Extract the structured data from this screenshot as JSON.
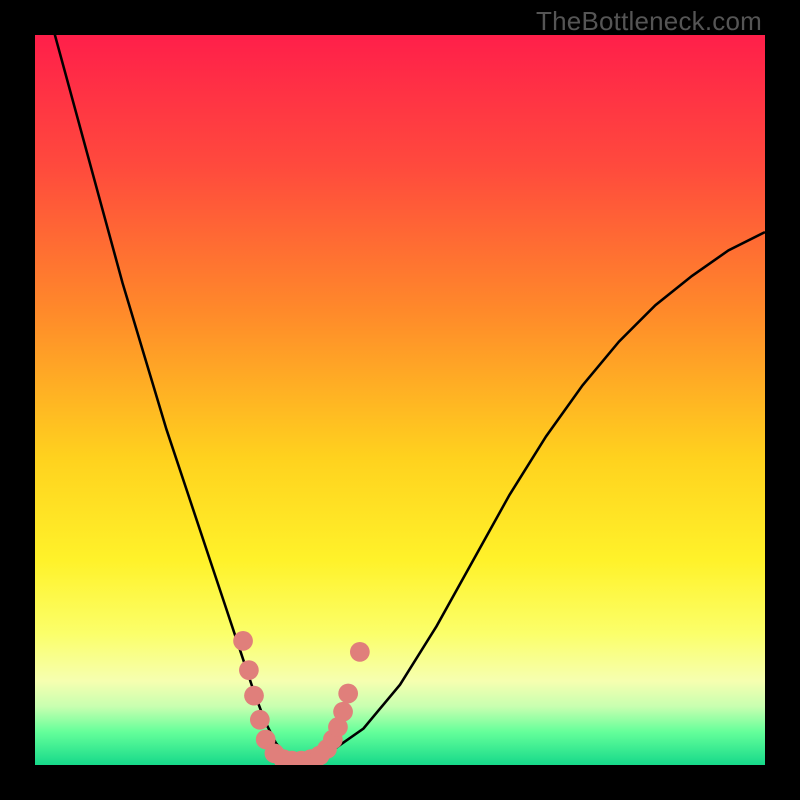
{
  "watermark": "TheBottleneck.com",
  "colors": {
    "frame": "#000000",
    "curve": "#000000",
    "marker": "#e07f7b",
    "gradient_stops": [
      {
        "offset": 0.0,
        "color": "#ff1f4a"
      },
      {
        "offset": 0.18,
        "color": "#ff4a3d"
      },
      {
        "offset": 0.38,
        "color": "#ff8a2a"
      },
      {
        "offset": 0.58,
        "color": "#ffd21e"
      },
      {
        "offset": 0.72,
        "color": "#fff22a"
      },
      {
        "offset": 0.82,
        "color": "#fbff6a"
      },
      {
        "offset": 0.885,
        "color": "#f6ffb0"
      },
      {
        "offset": 0.92,
        "color": "#c8ffb0"
      },
      {
        "offset": 0.955,
        "color": "#64ff9a"
      },
      {
        "offset": 1.0,
        "color": "#16d98a"
      }
    ]
  },
  "chart_data": {
    "type": "line",
    "title": "",
    "xlabel": "",
    "ylabel": "",
    "xlim": [
      0,
      100
    ],
    "ylim": [
      0,
      100
    ],
    "series": [
      {
        "name": "bottleneck-curve",
        "x": [
          0,
          3,
          6,
          9,
          12,
          15,
          18,
          21,
          24,
          26,
          28,
          30,
          31.5,
          33,
          34.5,
          36,
          40,
          45,
          50,
          55,
          60,
          65,
          70,
          75,
          80,
          85,
          90,
          95,
          100
        ],
        "y": [
          110,
          99,
          88,
          77,
          66,
          56,
          46,
          37,
          28,
          22,
          16,
          10,
          6,
          3,
          1.2,
          0.6,
          1.5,
          5,
          11,
          19,
          28,
          37,
          45,
          52,
          58,
          63,
          67,
          70.5,
          73
        ]
      }
    ],
    "markers": [
      {
        "x": 28.5,
        "y": 17
      },
      {
        "x": 29.3,
        "y": 13
      },
      {
        "x": 30.0,
        "y": 9.5
      },
      {
        "x": 30.8,
        "y": 6.2
      },
      {
        "x": 31.6,
        "y": 3.5
      },
      {
        "x": 32.8,
        "y": 1.6
      },
      {
        "x": 34.0,
        "y": 0.8
      },
      {
        "x": 35.2,
        "y": 0.6
      },
      {
        "x": 36.5,
        "y": 0.6
      },
      {
        "x": 37.8,
        "y": 0.8
      },
      {
        "x": 39.0,
        "y": 1.3
      },
      {
        "x": 40.0,
        "y": 2.2
      },
      {
        "x": 40.8,
        "y": 3.5
      },
      {
        "x": 41.5,
        "y": 5.2
      },
      {
        "x": 42.2,
        "y": 7.3
      },
      {
        "x": 42.9,
        "y": 9.8
      },
      {
        "x": 44.5,
        "y": 15.5
      }
    ]
  }
}
